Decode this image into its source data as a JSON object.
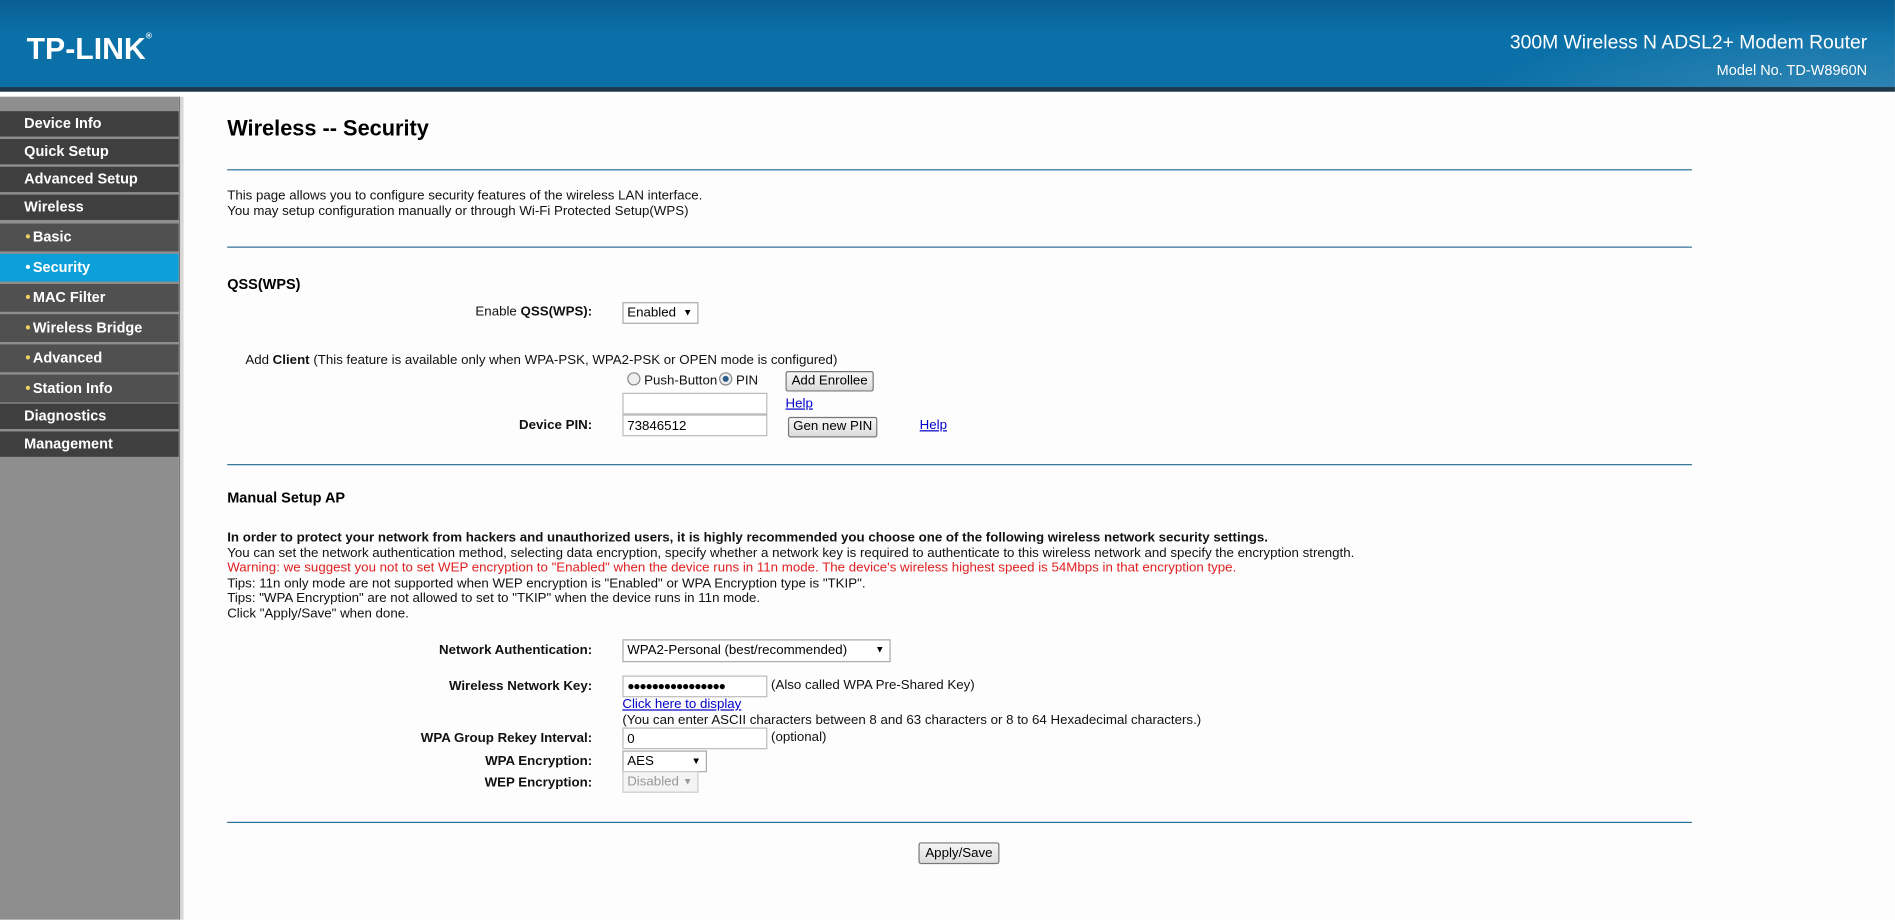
{
  "header": {
    "logo": "TP-LINK",
    "product": "300M Wireless N ADSL2+ Modem Router",
    "model": "Model No. TD-W8960N"
  },
  "sidebar": {
    "items": [
      {
        "label": "Device Info"
      },
      {
        "label": "Quick Setup"
      },
      {
        "label": "Advanced Setup"
      },
      {
        "label": "Wireless"
      },
      {
        "label": "Basic",
        "sub": true
      },
      {
        "label": "Security",
        "sub": true,
        "active": true
      },
      {
        "label": "MAC Filter",
        "sub": true
      },
      {
        "label": "Wireless Bridge",
        "sub": true
      },
      {
        "label": "Advanced",
        "sub": true
      },
      {
        "label": "Station Info",
        "sub": true
      },
      {
        "label": "Diagnostics"
      },
      {
        "label": "Management"
      }
    ],
    "bullet": "•"
  },
  "page": {
    "title": "Wireless -- Security",
    "intro1": "This page allows you to configure security features of the wireless LAN interface.",
    "intro2": "You may setup configuration manually or through Wi-Fi Protected Setup(WPS)"
  },
  "qss": {
    "heading": "QSS(WPS)",
    "enable_label_pre": "Enable ",
    "enable_label_bold": "QSS(WPS):",
    "enable_value": "Enabled",
    "add_client_pre": "Add ",
    "add_client_bold": "Client",
    "add_client_note": " (This feature is available only when WPA-PSK, WPA2-PSK or OPEN mode is configured)",
    "push_button": "Push-Button",
    "pin": "PIN",
    "add_enrollee": "Add Enrollee",
    "pin_input": "",
    "help1": "Help",
    "device_pin_label": "Device PIN:",
    "device_pin": "73846512",
    "gen_pin": "Gen new PIN",
    "help2": "Help"
  },
  "manual": {
    "heading": "Manual Setup AP",
    "line1": "In order to protect your network from hackers and unauthorized users, it is highly recommended you choose one of the following wireless network security settings.",
    "line2": "You can set the network authentication method, selecting data encryption, specify whether a network key is required to authenticate to this wireless network and specify the encryption strength.",
    "warning": "Warning: we suggest you not to set WEP encryption to \"Enabled\" when the device runs in 11n mode. The device's wireless highest speed is 54Mbps in that encryption type.",
    "tip1": "Tips: 11n only mode are not supported when WEP encryption is \"Enabled\" or WPA Encryption type is \"TKIP\".",
    "tip2": "Tips: \"WPA Encryption\" are not allowed to set to \"TKIP\" when the device runs in 11n mode.",
    "tip3": "Click \"Apply/Save\" when done.",
    "auth_label": "Network Authentication:",
    "auth_value": "WPA2-Personal (best/recommended)",
    "key_label": "Wireless Network Key:",
    "key_value": "●●●●●●●●●●●●●●●●",
    "key_note": "(Also called WPA Pre-Shared Key)",
    "display_link": "Click here to display",
    "key_hint": "(You can enter ASCII characters between 8 and 63 characters or 8 to 64 Hexadecimal characters.)",
    "rekey_label": "WPA Group Rekey Interval:",
    "rekey_value": "0",
    "optional": "(optional)",
    "wpa_enc_label": "WPA Encryption:",
    "wpa_enc_value": "AES",
    "wep_enc_label": "WEP Encryption:",
    "wep_enc_value": "Disabled",
    "apply": "Apply/Save"
  },
  "colors": {
    "accent": "#0d9fd8",
    "header": "#0a6fa6",
    "warning": "#e02020"
  }
}
